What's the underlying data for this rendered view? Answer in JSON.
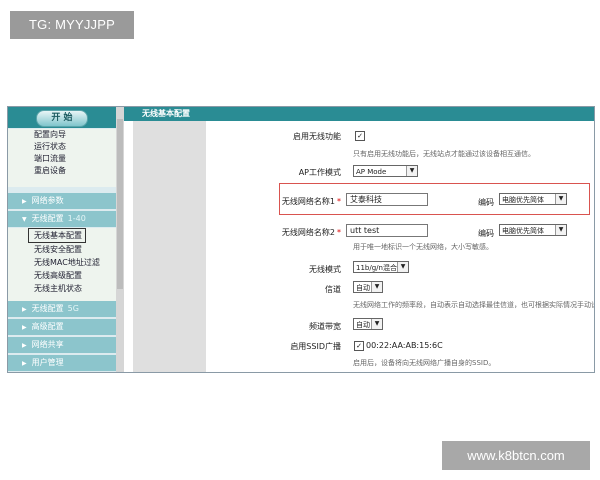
{
  "watermark_top": "TG: MYYJJPP",
  "watermark_bottom": "www.k8btcn.com",
  "sidebar": {
    "start_button": "开 始",
    "quick_items": [
      "配置向导",
      "运行状态",
      "端口流量",
      "重启设备"
    ],
    "sections": [
      {
        "label": "网络参数",
        "count": ""
      },
      {
        "label": "无线配置",
        "count": "1-40"
      }
    ],
    "wireless_items": [
      "无线基本配置",
      "无线安全配置",
      "无线MAC地址过滤",
      "无线高级配置",
      "无线主机状态"
    ],
    "sections_after": [
      {
        "label": "无线配置",
        "count": "5G"
      },
      {
        "label": "高级配置",
        "count": ""
      },
      {
        "label": "网络共享",
        "count": ""
      },
      {
        "label": "用户管理",
        "count": ""
      }
    ]
  },
  "header": {
    "title": "无线基本配置"
  },
  "form": {
    "enable_label": "启用无线功能",
    "enable_checked": "✓",
    "enable_desc": "只有启用无线功能后，无线站点才能通过该设备相互通信。",
    "ap_mode_label": "AP工作模式",
    "ap_mode_value": "AP Mode",
    "ssid1_label": "无线网络名称1",
    "ssid1_value": "艾泰科技",
    "encoding_label": "编码",
    "encoding1_value": "电脑优先简体",
    "ssid2_label": "无线网络名称2",
    "ssid2_value": "utt test",
    "encoding2_value": "电脑优先简体",
    "ssid2_desc": "用于唯一地标识一个无线网络，大小写敏感。",
    "mode_label": "无线模式",
    "mode_value": "11b/g/n混合",
    "channel_label": "信道",
    "channel_value": "自动",
    "channel_desc": "无线网络工作的频率段，自动表示自动选择最佳信道，也可根据实际情况手动设",
    "bandwidth_label": "频道带宽",
    "bandwidth_value": "自动",
    "broadcast_label": "启用SSID广播",
    "broadcast_checked": "✓",
    "broadcast_mac": "00:22:AA:AB:15:6C",
    "broadcast_desc": "启用后，设备将向无线网络广播自身的SSID。",
    "required_mark": "*",
    "dropdown_glyph": "▼"
  }
}
